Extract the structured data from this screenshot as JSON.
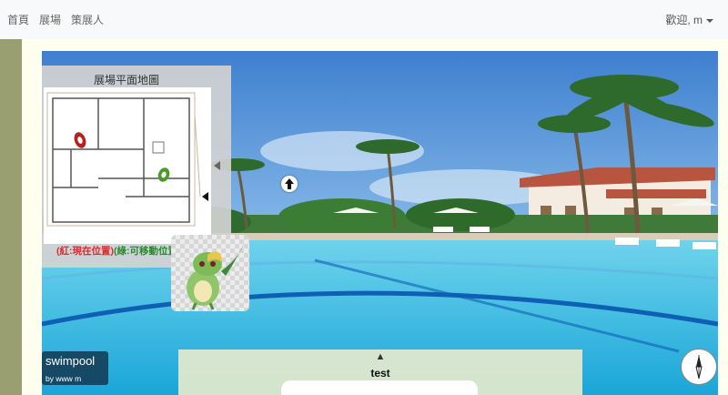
{
  "navbar": {
    "links": [
      "首頁",
      "展場",
      "策展人"
    ],
    "user_greeting": "歡迎, m"
  },
  "floor_map": {
    "title": "展場平面地圖",
    "legend_red": "(紅:現在位置)",
    "legend_green": "(綠:可移動位置)",
    "current_marker_color": "#b52020",
    "movable_marker_color": "#4a9a2a"
  },
  "scene": {
    "title": "swimpool",
    "author": "by www m"
  },
  "scene_panel": {
    "toggle_icon": "▲",
    "scene_name": "test"
  },
  "colors": {
    "sidebar": "#9a9f71",
    "frame": "#fffff0",
    "scene_label_bg": "#143750"
  },
  "icons": [
    "up-arrow-hotspot-icon",
    "compass-icon",
    "collapse-triangle-icon",
    "caret-down-icon"
  ]
}
